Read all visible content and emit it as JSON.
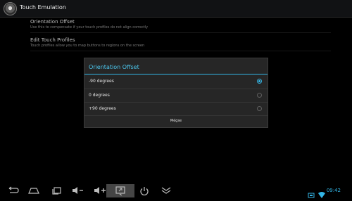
{
  "actionbar": {
    "title": "Touch Emulation",
    "icon": "joystick-app-icon"
  },
  "preferences": [
    {
      "title": "Orientation Offset",
      "summary": "Use this to compensate if your touch profiles do not align correctly"
    },
    {
      "title": "Edit Touch Profiles",
      "summary": "Touch profiles allow you to map buttons to regions on the screen"
    }
  ],
  "dialog": {
    "title": "Orientation Offset",
    "options": [
      {
        "label": "-90 degrees",
        "checked": true
      },
      {
        "label": "0 degrees",
        "checked": false
      },
      {
        "label": "+90 degrees",
        "checked": false
      }
    ],
    "button": "Mégse"
  },
  "navbar": {
    "icons": [
      "back-icon",
      "home-icon",
      "recent-apps-icon",
      "volume-down-icon",
      "volume-up-icon",
      "screenshot-icon",
      "power-icon",
      "collapse-icon"
    ],
    "status": {
      "time": "09:42",
      "icons": [
        "screen-icon",
        "wifi-icon"
      ]
    }
  },
  "colors": {
    "accent": "#33b5e5",
    "dialog_bg": "#262626",
    "background": "#000000"
  }
}
